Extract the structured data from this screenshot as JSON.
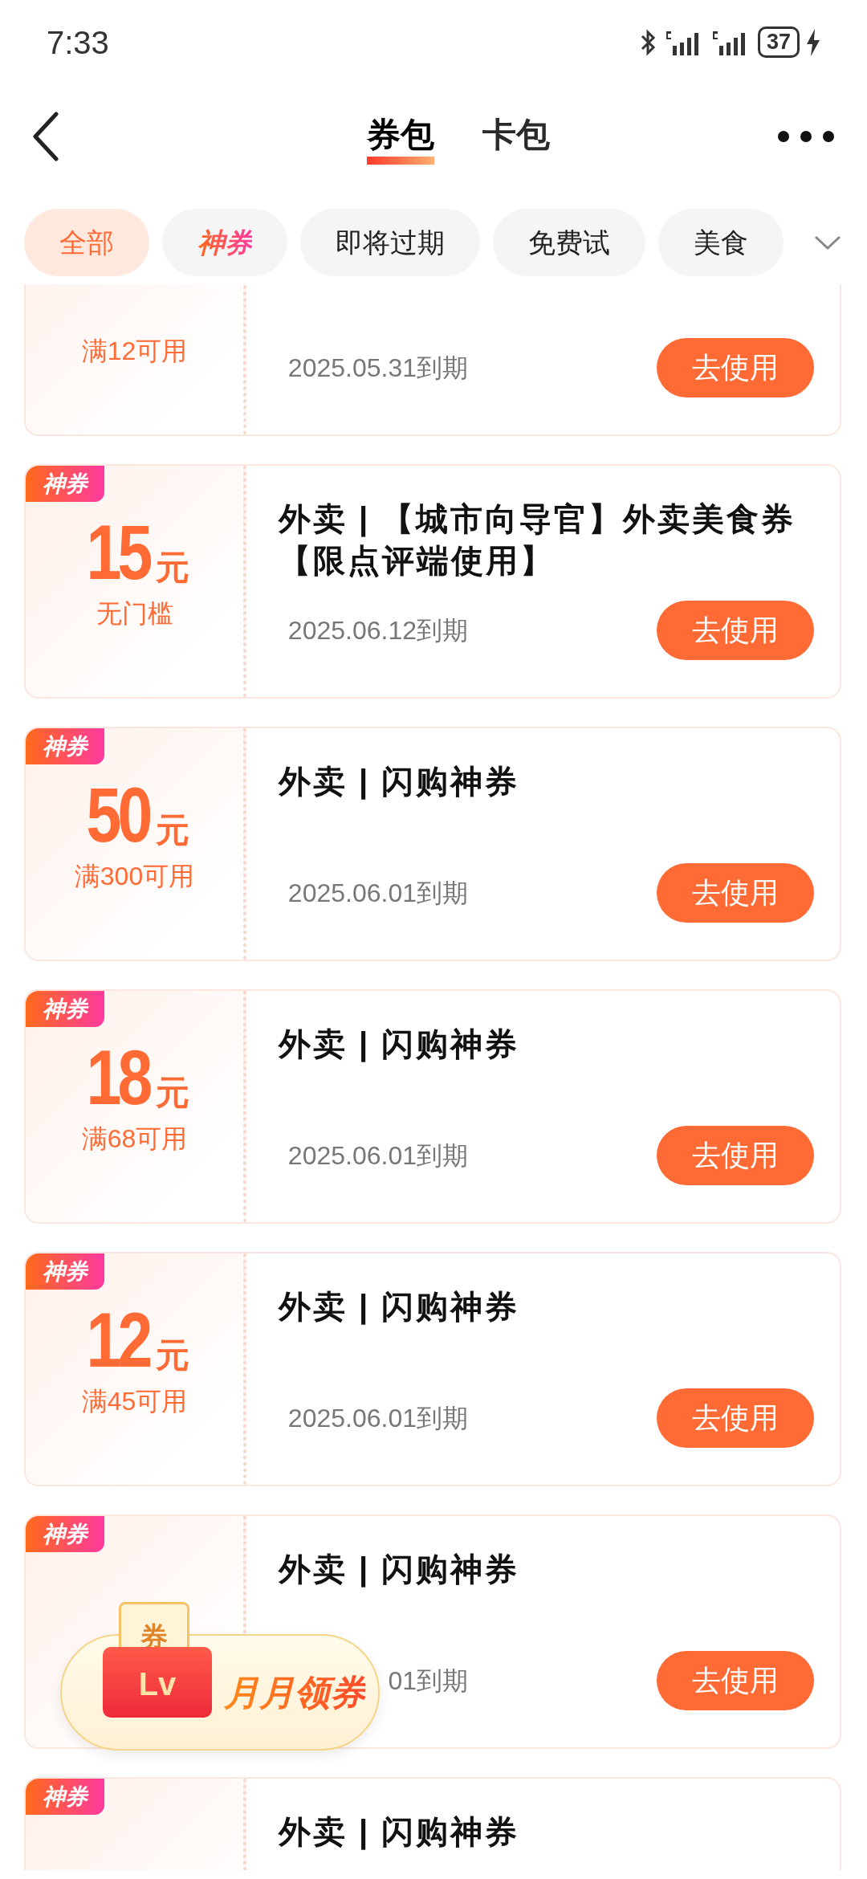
{
  "status_bar": {
    "time": "7:33",
    "battery": "37"
  },
  "tabs": [
    {
      "label": "券包",
      "selected": true
    },
    {
      "label": "卡包",
      "selected": false
    }
  ],
  "filters": [
    {
      "label": "全部",
      "selected": true,
      "kind": "plain"
    },
    {
      "label": "神券",
      "selected": false,
      "kind": "brand"
    },
    {
      "label": "即将过期",
      "selected": false,
      "kind": "plain"
    },
    {
      "label": "免费试",
      "selected": false,
      "kind": "plain"
    },
    {
      "label": "美食",
      "selected": false,
      "kind": "plain"
    }
  ],
  "coupons": [
    {
      "condition": "满12可用",
      "expiry": "2025.05.31到期",
      "button": "去使用"
    },
    {
      "badge": "神券",
      "amount": "15",
      "unit": "元",
      "condition": "无门槛",
      "title": "外卖 | 【城市向导官】外卖美食券【限点评端使用】",
      "expiry": "2025.06.12到期",
      "button": "去使用"
    },
    {
      "badge": "神券",
      "amount": "50",
      "unit": "元",
      "condition": "满300可用",
      "title": "外卖 | 闪购神券",
      "expiry": "2025.06.01到期",
      "button": "去使用"
    },
    {
      "badge": "神券",
      "amount": "18",
      "unit": "元",
      "condition": "满68可用",
      "title": "外卖 | 闪购神券",
      "expiry": "2025.06.01到期",
      "button": "去使用"
    },
    {
      "badge": "神券",
      "amount": "12",
      "unit": "元",
      "condition": "满45可用",
      "title": "外卖 | 闪购神券",
      "expiry": "2025.06.01到期",
      "button": "去使用"
    },
    {
      "badge": "神券",
      "title": "外卖 | 闪购神券",
      "expiry": "01到期",
      "button": "去使用"
    },
    {
      "badge": "神券",
      "title": "外卖 | 闪购神券"
    }
  ],
  "promo": {
    "envelope_top": "券",
    "envelope_label": "Lv",
    "label": "月月领券"
  }
}
